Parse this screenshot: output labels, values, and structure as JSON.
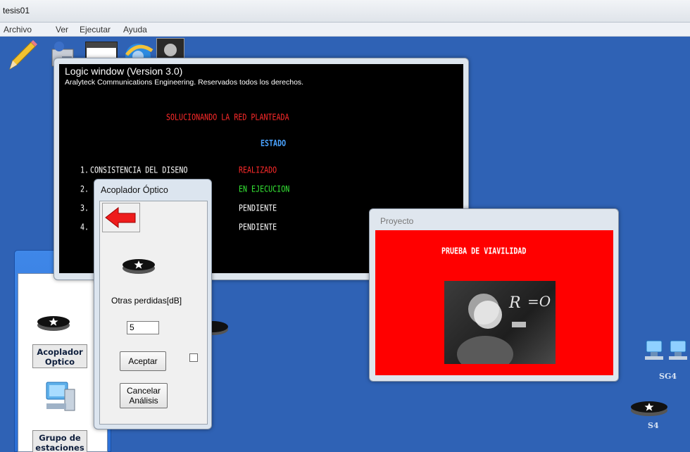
{
  "window": {
    "title": "tesis01"
  },
  "menu": {
    "items": [
      "Archivo",
      "Ver",
      "Ejecutar",
      "Ayuda"
    ]
  },
  "toolbar": {
    "icons": [
      "pencil-icon",
      "network-tools-icon",
      "window-icon",
      "browser-globe-icon",
      "einstein-photo-icon"
    ]
  },
  "logic_window": {
    "title": "Logic window (Version 3.0)",
    "subtitle": "Aralyteck Communications Engineering.  Reservados todos los derechos.",
    "heading": "SOLUCIONANDO LA RED PLANTEADA",
    "status_header": "ESTADO",
    "steps": [
      {
        "num": "1.",
        "name": "CONSISTENCIA DEL DISENO",
        "status": "REALIZADO",
        "color": "#ff2a2a"
      },
      {
        "num": "2.",
        "name": "",
        "status": "EN EJECUCION",
        "color": "#35e835"
      },
      {
        "num": "3.",
        "name": "",
        "status": "PENDIENTE",
        "color": "#ffffff"
      },
      {
        "num": "4.",
        "name": "",
        "status": "PENDIENTE",
        "color": "#ffffff"
      }
    ]
  },
  "dialog": {
    "title": "Acoplador Óptico",
    "back_icon": "red-left-arrow-icon",
    "label": "Otras perdidas[dB]",
    "value": "5",
    "accept": "Aceptar",
    "cancel_line1": "Cancelar",
    "cancel_line2": "Análisis"
  },
  "proyecto": {
    "title": "Proyecto",
    "heading": "PRUEBA DE VIAVILIDAD",
    "background_color": "#ff0000"
  },
  "palette": {
    "item1": "Acoplador Optico",
    "item2": "Grupo de estaciones"
  },
  "nodes": {
    "sg4": "SG4",
    "s4": "S4"
  }
}
